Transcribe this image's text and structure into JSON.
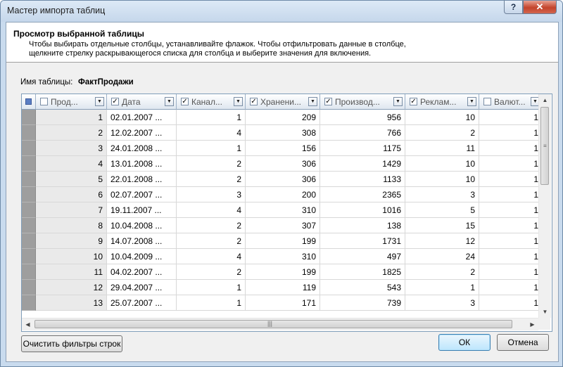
{
  "window": {
    "title": "Мастер импорта таблиц",
    "help_label": "?",
    "close_label": "✕"
  },
  "header": {
    "title": "Просмотр выбранной таблицы",
    "description": "Чтобы выбирать отдельные столбцы, устанавливайте флажок. Чтобы отфильтровать данные в столбце,\nщелкните стрелку раскрывающегося списка для столбца и выберите значения для включения."
  },
  "table_name": {
    "label": "Имя таблицы:",
    "value": "ФактПродажи"
  },
  "grid": {
    "columns": [
      {
        "label": "Прод...",
        "checked": false
      },
      {
        "label": "Дата",
        "checked": true
      },
      {
        "label": "Канал...",
        "checked": true
      },
      {
        "label": "Хранени...",
        "checked": true
      },
      {
        "label": "Производ...",
        "checked": true
      },
      {
        "label": "Реклам...",
        "checked": true
      },
      {
        "label": "Валют...",
        "checked": false
      }
    ],
    "rows": [
      [
        "1",
        "02.01.2007 ...",
        "1",
        "209",
        "956",
        "10",
        "1"
      ],
      [
        "2",
        "12.02.2007 ...",
        "4",
        "308",
        "766",
        "2",
        "1"
      ],
      [
        "3",
        "24.01.2008 ...",
        "1",
        "156",
        "1175",
        "11",
        "1"
      ],
      [
        "4",
        "13.01.2008 ...",
        "2",
        "306",
        "1429",
        "10",
        "1"
      ],
      [
        "5",
        "22.01.2008 ...",
        "2",
        "306",
        "1133",
        "10",
        "1"
      ],
      [
        "6",
        "02.07.2007 ...",
        "3",
        "200",
        "2365",
        "3",
        "1"
      ],
      [
        "7",
        "19.11.2007 ...",
        "4",
        "310",
        "1016",
        "5",
        "1"
      ],
      [
        "8",
        "10.04.2008 ...",
        "2",
        "307",
        "138",
        "15",
        "1"
      ],
      [
        "9",
        "14.07.2008 ...",
        "2",
        "199",
        "1731",
        "12",
        "1"
      ],
      [
        "10",
        "10.04.2009 ...",
        "4",
        "310",
        "497",
        "24",
        "1"
      ],
      [
        "11",
        "04.02.2007 ...",
        "2",
        "199",
        "1825",
        "2",
        "1"
      ],
      [
        "12",
        "29.04.2007 ...",
        "1",
        "119",
        "543",
        "1",
        "1"
      ],
      [
        "13",
        "25.07.2007 ...",
        "1",
        "171",
        "739",
        "3",
        "1"
      ]
    ]
  },
  "buttons": {
    "clear_filters": "Очистить фильтры строк",
    "ok": "ОК",
    "cancel": "Отмена"
  }
}
